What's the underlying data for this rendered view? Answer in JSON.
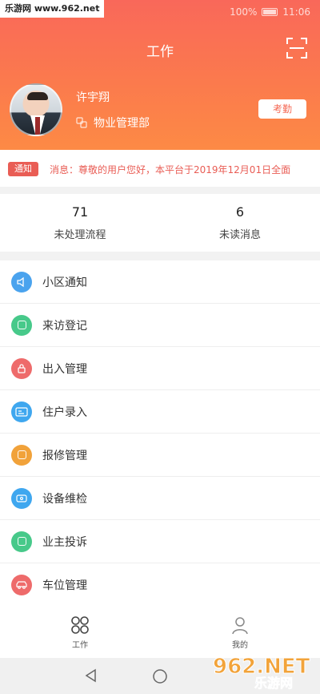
{
  "watermark": "乐游网 www.962.net",
  "status_bar": {
    "battery": "100%",
    "time": "11:06"
  },
  "header": {
    "title": "工作",
    "scan_icon": "scan-icon"
  },
  "user": {
    "name": "许宇翔",
    "department": "物业管理部",
    "attendance_button": "考勤"
  },
  "notice": {
    "tag": "通知",
    "text": "消息：尊敬的用户您好，本平台于2019年12月01日全面"
  },
  "stats": [
    {
      "value": "71",
      "label": "未处理流程"
    },
    {
      "value": "6",
      "label": "未读消息"
    }
  ],
  "menu": [
    {
      "label": "小区通知",
      "icon": "speaker-icon",
      "color": "#4aa3ee"
    },
    {
      "label": "来访登记",
      "icon": "register-icon",
      "color": "#47c98a"
    },
    {
      "label": "出入管理",
      "icon": "lock-icon",
      "color": "#ee6b6b"
    },
    {
      "label": "住户录入",
      "icon": "id-card-icon",
      "color": "#3fa7ef"
    },
    {
      "label": "报修管理",
      "icon": "wrench-icon",
      "color": "#f1a23a"
    },
    {
      "label": "设备维检",
      "icon": "device-icon",
      "color": "#3fa7ef"
    },
    {
      "label": "业主投诉",
      "icon": "complaint-icon",
      "color": "#47c98a"
    },
    {
      "label": "车位管理",
      "icon": "car-icon",
      "color": "#ee6b6b"
    }
  ],
  "tabbar": [
    {
      "label": "工作",
      "icon": "grid-icon"
    },
    {
      "label": "我的",
      "icon": "person-icon"
    }
  ],
  "brand_mark": {
    "logo": "962.NET",
    "name": "乐游网"
  },
  "colors": {
    "header_top": "#f9685a",
    "header_bottom": "#fd8a45",
    "notice_red": "#e95d55"
  }
}
